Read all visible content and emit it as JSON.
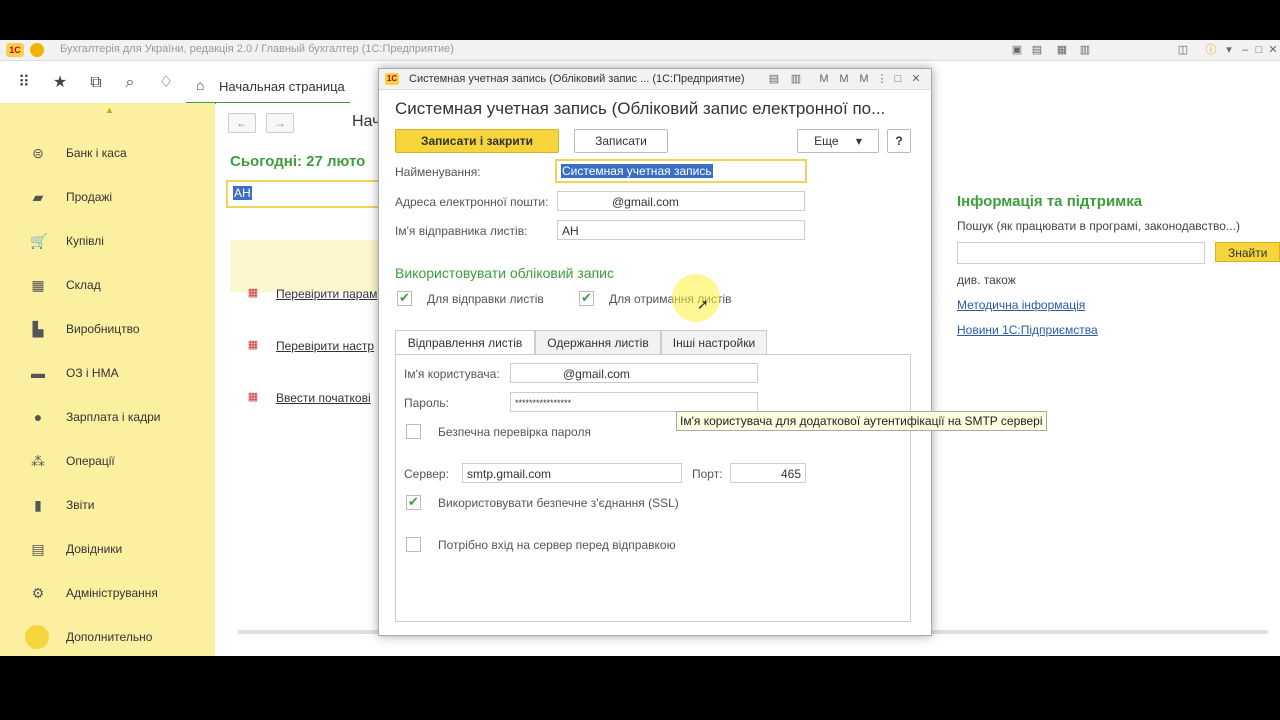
{
  "window": {
    "title": "Бухгалтерія для України, редакція 2.0 / Главный бухгалтер (1С:Предприятие)",
    "logo_text": "1С"
  },
  "toolbar": {
    "home_tab": "Начальная страница",
    "icons": [
      "apps-grid-icon",
      "star-icon",
      "history-icon",
      "search-icon",
      "bell-icon"
    ]
  },
  "sidebar": {
    "items": [
      {
        "label": "Банк і каса",
        "icon": "bank-icon",
        "glyph": "⊜"
      },
      {
        "label": "Продажі",
        "icon": "bag-icon",
        "glyph": "▰"
      },
      {
        "label": "Купівлі",
        "icon": "cart-icon",
        "glyph": "🛒"
      },
      {
        "label": "Склад",
        "icon": "warehouse-icon",
        "glyph": "▦"
      },
      {
        "label": "Виробництво",
        "icon": "factory-icon",
        "glyph": "▙"
      },
      {
        "label": "ОЗ і НМА",
        "icon": "truck-icon",
        "glyph": "▬"
      },
      {
        "label": "Зарплата і кадри",
        "icon": "person-icon",
        "glyph": "●"
      },
      {
        "label": "Операції",
        "icon": "operations-icon",
        "glyph": "⁂"
      },
      {
        "label": "Звіти",
        "icon": "bar-chart-icon",
        "glyph": "▮"
      },
      {
        "label": "Довідники",
        "icon": "books-icon",
        "glyph": "▤"
      },
      {
        "label": "Адміністрування",
        "icon": "gear-icon",
        "glyph": "⚙"
      },
      {
        "label": "Дополнительно",
        "icon": "circle-icon",
        "glyph": ""
      }
    ]
  },
  "main": {
    "title": "Нач",
    "today": "Сьогодні: 27 люто",
    "todo_input_value": "АН",
    "tasks": [
      "Перевірити парам",
      "Перевірити настр",
      "Ввести початкові"
    ],
    "info": {
      "title": "Інформація та підтримка",
      "search_hint": "Пошук (як працювати в програмі, законодавство...)",
      "find_button": "Знайти",
      "see_also": "див. також",
      "links": [
        "Методична інформація",
        "Новини 1С:Підприємства"
      ]
    }
  },
  "dialog": {
    "window_title": "Системная учетная запись (Обліковий запис ...  (1С:Предприятие)",
    "heading": "Системная учетная запись (Обліковий запис електронної по...",
    "save_close": "Записати і закрити",
    "save": "Записати",
    "more": "Еще",
    "more_arrow": "▾",
    "help": "?",
    "fields": {
      "name_label": "Найменування:",
      "name_value": "Системная учетная запись",
      "email_label": "Адреса електронної пошти:",
      "email_value": "@gmail.com",
      "sender_label": "Ім'я відправника листів:",
      "sender_value": "АН"
    },
    "use_title": "Використовувати обліковий запис",
    "checks": {
      "send": "Для відправки листів",
      "receive": "Для отримання листів"
    },
    "tabs": [
      "Відправлення листів",
      "Одержання листів",
      "Інші настройки"
    ],
    "send_tab": {
      "user_label": "Ім'я користувача:",
      "user_value": "@gmail.com",
      "password_label": "Пароль:",
      "password_value": "****************",
      "secure_check_label": "Безпечна перевірка пароля",
      "server_label": "Сервер:",
      "server_value": "smtp.gmail.com",
      "port_label": "Порт:",
      "port_value": "465",
      "ssl_label": "Використовувати безпечне з'єднання (SSL)",
      "login_before_label": "Потрібно вхід на сервер перед відправкою"
    },
    "tooltip": "Ім'я користувача для додаткової аутентифікації на SMTP сервері"
  },
  "colors": {
    "accent_green": "#3c9e3c",
    "sidebar_yellow": "#fbefa0",
    "primary_button": "#f5d43c",
    "selection_blue": "#3a6fc4",
    "link_blue": "#2b59a8"
  }
}
